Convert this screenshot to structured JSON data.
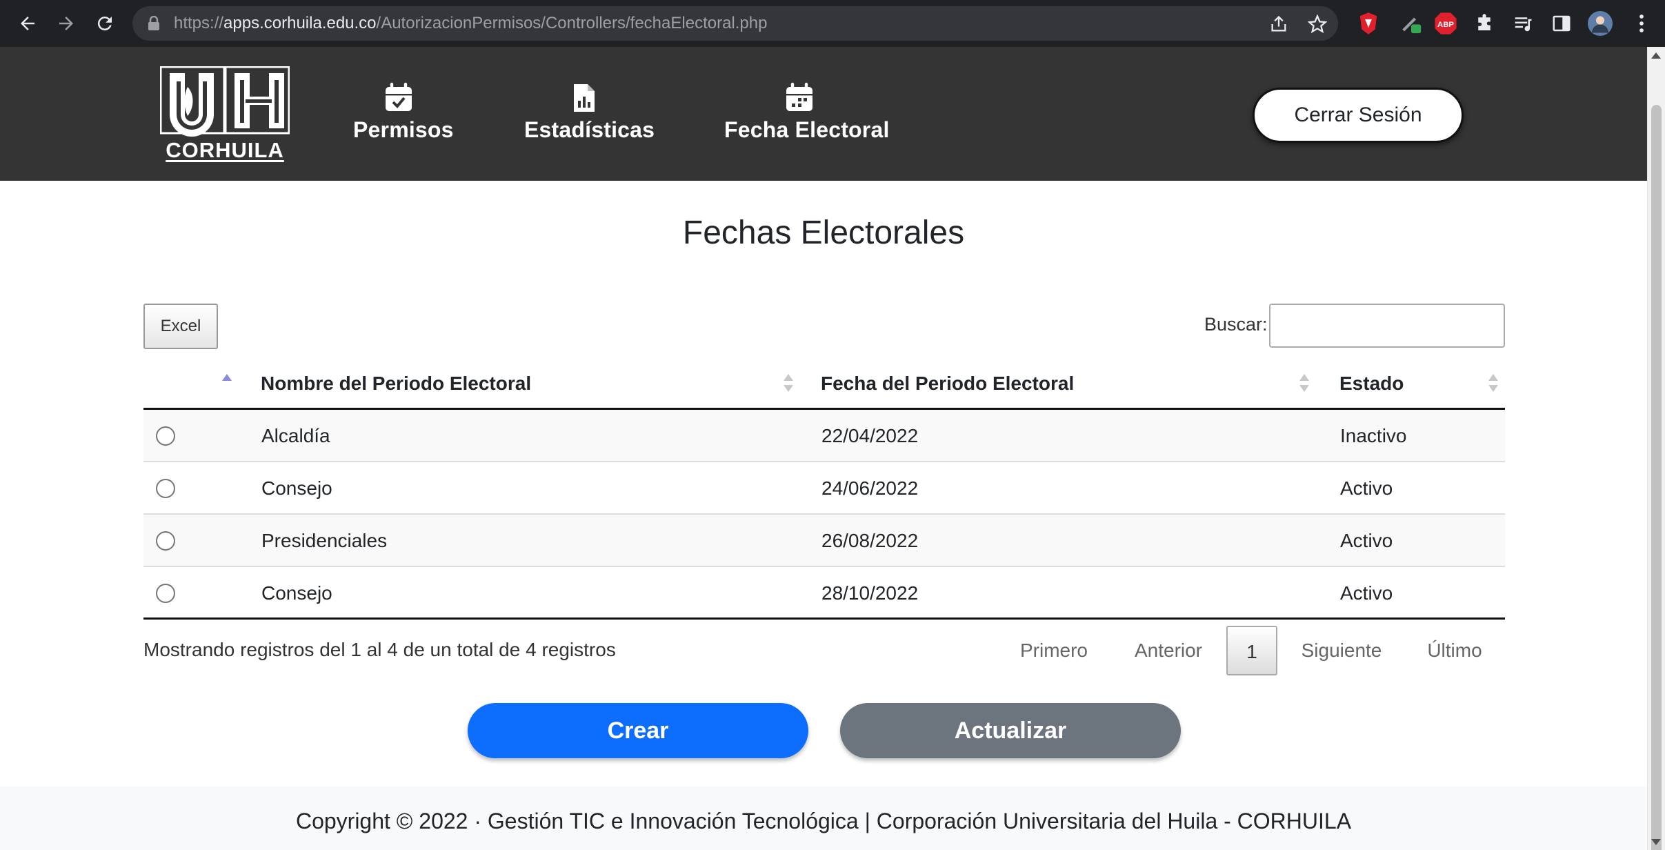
{
  "browser": {
    "url_prefix": "https://",
    "url_host": "apps.corhuila.edu.co",
    "url_path": "/AutorizacionPermisos/Controllers/fechaElectoral.php",
    "ext_abp_label": "ABP"
  },
  "site": {
    "logo_text": "CORHUILA",
    "nav": [
      {
        "label": "Permisos",
        "icon": "calendar-check-icon"
      },
      {
        "label": "Estadísticas",
        "icon": "file-chart-icon"
      },
      {
        "label": "Fecha Electoral",
        "icon": "calendar-week-icon"
      }
    ],
    "logout_label": "Cerrar Sesión"
  },
  "main": {
    "title": "Fechas Electorales",
    "excel_label": "Excel",
    "search_label": "Buscar:",
    "search_value": "",
    "table": {
      "columns": [
        "Nombre del Periodo Electoral",
        "Fecha del Periodo Electoral",
        "Estado"
      ],
      "rows": [
        {
          "nombre": "Alcaldía",
          "fecha": "22/04/2022",
          "estado": "Inactivo"
        },
        {
          "nombre": "Consejo",
          "fecha": "24/06/2022",
          "estado": "Activo"
        },
        {
          "nombre": "Presidenciales",
          "fecha": "26/08/2022",
          "estado": "Activo"
        },
        {
          "nombre": "Consejo",
          "fecha": "28/10/2022",
          "estado": "Activo"
        }
      ]
    },
    "info_text": "Mostrando registros del 1 al 4 de un total de 4 registros",
    "pagination": {
      "first": "Primero",
      "previous": "Anterior",
      "current": "1",
      "next": "Siguiente",
      "last": "Último"
    },
    "create_label": "Crear",
    "update_label": "Actualizar"
  },
  "footer": {
    "text": "Copyright © 2022 · Gestión TIC e Innovación Tecnológica | Corporación Universitaria del Huila - CORHUILA"
  },
  "colors": {
    "navbar_bg": "#343434",
    "primary": "#0d6efd",
    "secondary": "#6c757d",
    "footer_bg": "#f8f9fa"
  }
}
